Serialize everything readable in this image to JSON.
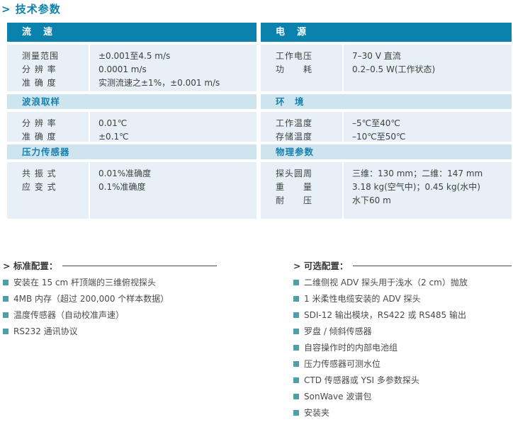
{
  "page_title": "> 技术参数",
  "colors": {
    "section_header_bg": "#0b81ae",
    "subheader_bg": "#cee4ee",
    "subheader_text": "#1581af",
    "body_bg": "#e6f0f6",
    "bullet": "#4f9fa6"
  },
  "spec_table": {
    "left_sections": [
      {
        "header": "流　速",
        "rows": [
          {
            "label": "测量范围",
            "value": "±0.001至4.5 m/s"
          },
          {
            "label": "分 辨 率",
            "value": "0.0001 m/s"
          },
          {
            "label": "准 确 度",
            "value": "实测流速之±1%，±0.001 m/s"
          }
        ]
      },
      {
        "header": "波浪取样",
        "rows": [
          {
            "label": "分 辨 率",
            "value": "0.01℃"
          },
          {
            "label": "准 确 度",
            "value": "±0.1℃"
          }
        ]
      },
      {
        "header": "压力传感器",
        "rows": [
          {
            "label": "共 振 式",
            "value": "0.01%准确度"
          },
          {
            "label": "应 变 式",
            "value": "0.1%准确度"
          }
        ]
      }
    ],
    "right_sections": [
      {
        "header": "电　源",
        "rows": [
          {
            "label": "工作电压",
            "value": "7–30 V 直流"
          },
          {
            "label": "功　　耗",
            "value": "0.2–0.5 W(工作状态)"
          }
        ]
      },
      {
        "header": "环　境",
        "rows": [
          {
            "label": "工作温度",
            "value": "–5℃至40℃"
          },
          {
            "label": "存储温度",
            "value": "–10℃至50℃"
          }
        ]
      },
      {
        "header": "物理参数",
        "rows": [
          {
            "label": "探头圆周",
            "value": "三维：130 mm；二维：147 mm"
          },
          {
            "label": "重　　量",
            "value": "3.18 kg(空气中)；0.45 kg(水中)"
          },
          {
            "label": "耐　　压",
            "value": "水下60 m"
          }
        ]
      }
    ]
  },
  "standard_config": {
    "title": "> 标准配置：",
    "items": [
      "安装在 15 cm 杆顶端的三维俯视探头",
      "4MB 内存（超过 200,000 个样本数据）",
      "温度传感器（自动校准声速）",
      "RS232 通讯协议"
    ]
  },
  "optional_config": {
    "title": "> 可选配置：",
    "items": [
      "二维侧视 ADV 探头用于浅水（2 cm）抛放",
      "1 米柔性电缆安装的 ADV 探头",
      "SDI-12 输出模块，RS422 或 RS485 输出",
      "罗盘 / 倾斜传感器",
      "自容操作时的内部电池组",
      "压力传感器可测水位",
      "CTD 传感器或 YSI 多参数探头",
      "SonWave 波谱包",
      "安装夹"
    ]
  }
}
